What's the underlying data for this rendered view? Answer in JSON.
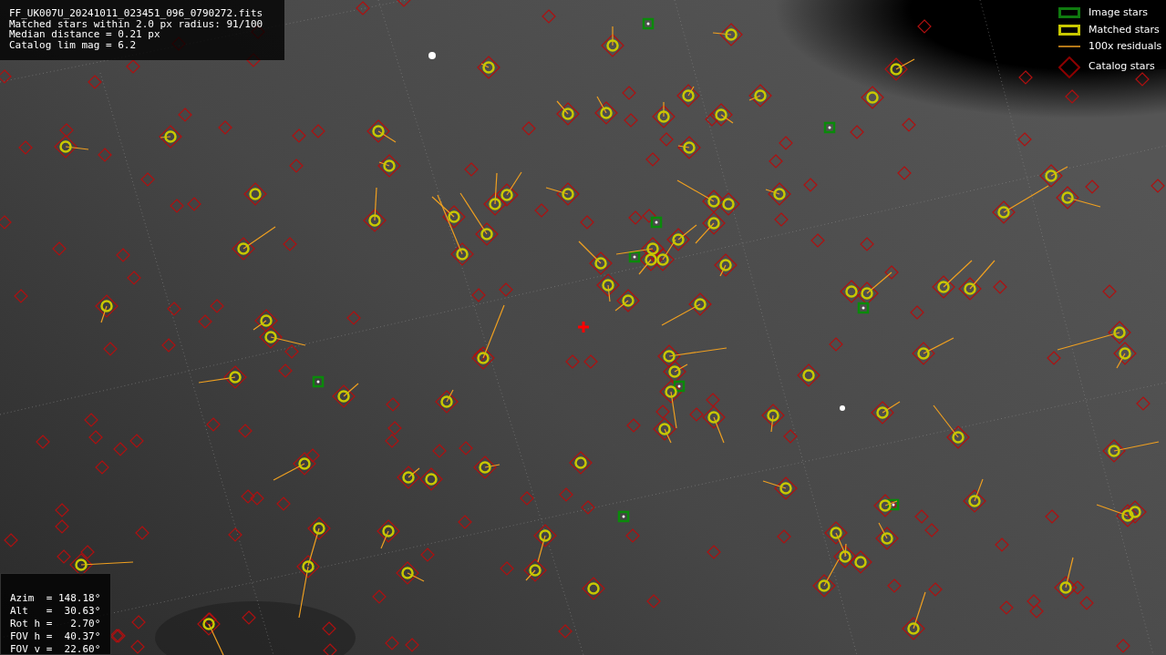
{
  "info_panel": {
    "lines": [
      "FF_UK007U_20241011_023451_096_0790272.fits",
      "Matched stars within 2.0 px radius: 91/100",
      "Median distance = 0.21 px",
      "Catalog lim mag = 6.2"
    ]
  },
  "legend": [
    {
      "kind": "image",
      "label": "Image stars"
    },
    {
      "kind": "matched",
      "label": "Matched stars"
    },
    {
      "kind": "residual",
      "label": "100x residuals"
    },
    {
      "kind": "catalog",
      "label": "Catalog stars"
    }
  ],
  "pointing_panel": {
    "lines": [
      "Azim  = 148.18°",
      "Alt   =  30.63°",
      "Rot h =   2.70°",
      "FOV h =  40.37°",
      "FOV v =  22.60°"
    ]
  }
}
